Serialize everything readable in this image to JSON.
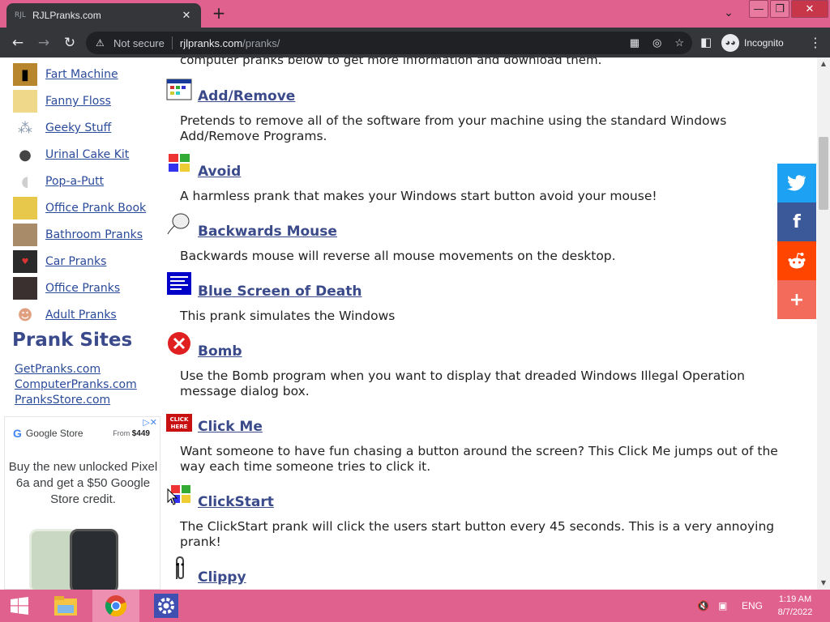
{
  "browser": {
    "tab_title": "RJLPranks.com",
    "tab_favicon": "RJL",
    "url_warning": "Not secure",
    "url_host": "rjlpranks.com",
    "url_path": "/pranks/",
    "profile_label": "Incognito"
  },
  "sidebar": {
    "items": [
      {
        "label": "Fart Machine",
        "icon": "fart-machine-thumb"
      },
      {
        "label": "Fanny Floss",
        "icon": "fanny-floss-thumb"
      },
      {
        "label": "Geeky Stuff",
        "icon": "geeky-stuff-thumb"
      },
      {
        "label": "Urinal Cake Kit",
        "icon": "urinal-cake-thumb"
      },
      {
        "label": "Pop-a-Putt",
        "icon": "pop-a-putt-thumb"
      },
      {
        "label": "Office Prank Book",
        "icon": "office-prank-book-thumb"
      },
      {
        "label": "Bathroom Pranks",
        "icon": "bathroom-pranks-thumb"
      },
      {
        "label": "Car Pranks",
        "icon": "car-pranks-thumb"
      },
      {
        "label": "Office Pranks",
        "icon": "office-pranks-thumb"
      },
      {
        "label": "Adult Pranks",
        "icon": "adult-pranks-thumb"
      }
    ],
    "sites_title": "Prank Sites",
    "sites": [
      "GetPranks.com",
      "ComputerPranks.com",
      "PranksStore.com"
    ]
  },
  "ad": {
    "brand": "Google Store",
    "price_prefix": "From",
    "price": "$449",
    "text": "Buy the new unlocked Pixel 6a and get a $50 Google Store credit."
  },
  "main": {
    "intro": "computer pranks below to get more information and download them.",
    "entries": [
      {
        "title": "Add/Remove",
        "icon": "add-remove-icon",
        "desc": "Pretends to remove all of the software from your machine using the standard Windows Add/Remove Programs."
      },
      {
        "title": "Avoid",
        "icon": "windows-flag-icon",
        "desc": "A harmless prank that makes your Windows start button avoid your mouse!"
      },
      {
        "title": "Backwards Mouse",
        "icon": "mouse-icon",
        "desc": "Backwards mouse will reverse all mouse movements on the desktop."
      },
      {
        "title": "Blue Screen of Death",
        "icon": "blue-screen-icon",
        "desc": "This prank simulates the Windows"
      },
      {
        "title": "Bomb",
        "icon": "error-icon",
        "desc": "Use the Bomb program when you want to display that dreaded Windows Illegal Operation message dialog box."
      },
      {
        "title": "Click Me",
        "icon": "click-here-icon",
        "desc": "Want someone to have fun chasing a button around the screen? This Click Me jumps out of the way each time someone tries to click it."
      },
      {
        "title": "ClickStart",
        "icon": "windows-cursor-icon",
        "desc": "The ClickStart prank will click the users start button every 45 seconds. This is a very annoying prank!"
      },
      {
        "title": "Clippy",
        "icon": "paperclip-icon",
        "desc": ""
      }
    ]
  },
  "share": [
    {
      "name": "twitter",
      "glyph": "🐦",
      "color": "#1da1f2"
    },
    {
      "name": "facebook",
      "glyph": "f",
      "color": "#3b5998"
    },
    {
      "name": "reddit",
      "glyph": "👽",
      "color": "#ff4500"
    },
    {
      "name": "more",
      "glyph": "+",
      "color": "#f26b5b"
    }
  ],
  "taskbar": {
    "language": "ENG",
    "time": "1:19 AM",
    "date": "8/7/2022"
  }
}
